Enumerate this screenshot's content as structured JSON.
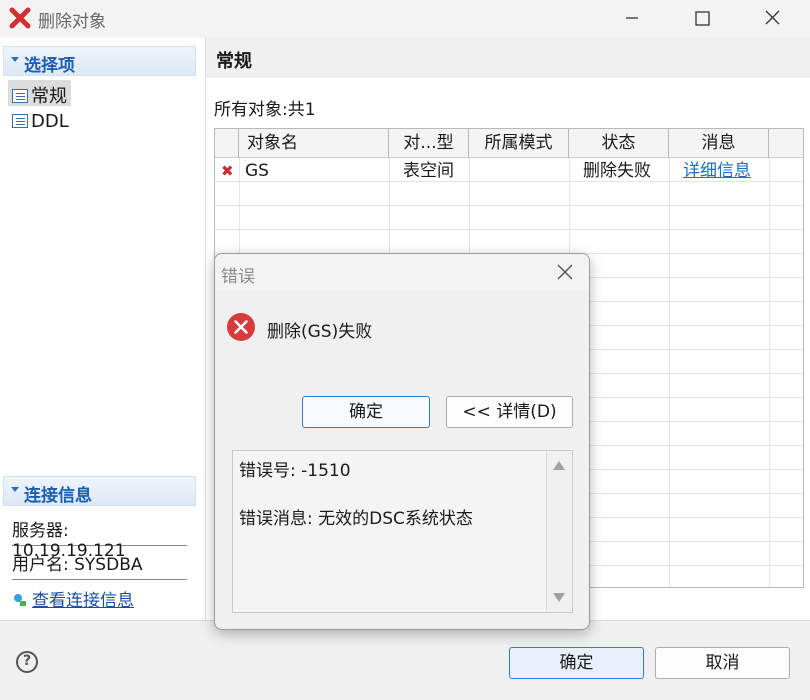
{
  "window": {
    "title": "删除对象"
  },
  "sidebar": {
    "select_header": "选择项",
    "items": [
      {
        "label": "常规",
        "icon": "table-icon",
        "selected": true
      },
      {
        "label": "DDL",
        "icon": "table-icon",
        "selected": false
      }
    ],
    "connection_header": "连接信息",
    "server": "服务器: 10.19.19.121",
    "user": "用户名: SYSDBA",
    "view_connection_link": "查看连接信息"
  },
  "main": {
    "header": "常规",
    "count_label": "所有对象:共1",
    "table": {
      "columns": [
        "",
        "对象名",
        "对...型",
        "所属模式",
        "状态",
        "消息"
      ],
      "rows": [
        {
          "icon": "✖",
          "name": "GS",
          "type": "表空间",
          "schema": "",
          "status": "删除失败",
          "message": "详细信息"
        }
      ]
    }
  },
  "footer": {
    "ok_label": "确定",
    "cancel_label": "取消"
  },
  "dialog": {
    "title": "错误",
    "message": "删除(GS)失败",
    "ok_label": "确定",
    "details_label": "<< 详情(D)",
    "error_code_line": "错误号:  -1510",
    "error_message_line": "错误消息: 无效的DSC系统状态"
  },
  "colors": {
    "accent": "#1a5fb4",
    "error": "#d83b3b",
    "link": "#1a6fc8"
  }
}
